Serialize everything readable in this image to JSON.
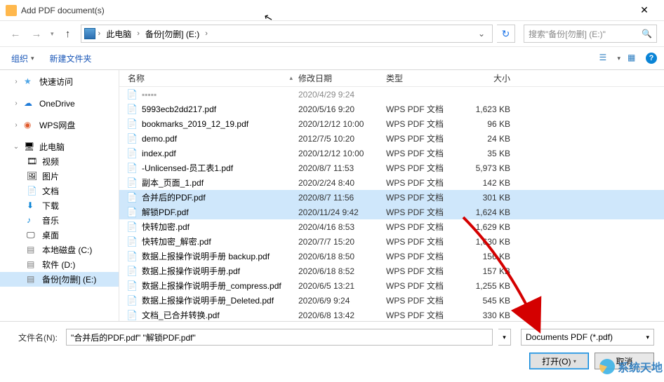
{
  "title": "Add PDF document(s)",
  "breadcrumb": {
    "root": "此电脑",
    "folder": "备份[勿删] (E:)"
  },
  "search": {
    "placeholder": "搜索\"备份[勿删] (E:)\""
  },
  "toolbar": {
    "organize": "组织",
    "newfolder": "新建文件夹"
  },
  "columns": {
    "name": "名称",
    "date": "修改日期",
    "type": "类型",
    "size": "大小"
  },
  "sidebar": {
    "quick": "快速访问",
    "onedrive": "OneDrive",
    "wps": "WPS网盘",
    "thispc": "此电脑",
    "video": "视频",
    "pic": "图片",
    "doc": "文档",
    "down": "下载",
    "music": "音乐",
    "desk": "桌面",
    "diskc": "本地磁盘 (C:)",
    "diskd": "软件 (D:)",
    "diske": "备份[勿删] (E:)"
  },
  "files": [
    {
      "name": "5993ecb2dd217.pdf",
      "date": "2020/5/16 9:20",
      "type": "WPS PDF 文档",
      "size": "1,623 KB",
      "sel": false
    },
    {
      "name": "bookmarks_2019_12_19.pdf",
      "date": "2020/12/12 10:00",
      "type": "WPS PDF 文档",
      "size": "96 KB",
      "sel": false
    },
    {
      "name": "demo.pdf",
      "date": "2012/7/5 10:20",
      "type": "WPS PDF 文档",
      "size": "24 KB",
      "sel": false
    },
    {
      "name": "index.pdf",
      "date": "2020/12/12 10:00",
      "type": "WPS PDF 文档",
      "size": "35 KB",
      "sel": false
    },
    {
      "name": "-Unlicensed-员工表1.pdf",
      "date": "2020/8/7 11:53",
      "type": "WPS PDF 文档",
      "size": "5,973 KB",
      "sel": false
    },
    {
      "name": "副本_页面_1.pdf",
      "date": "2020/2/24 8:40",
      "type": "WPS PDF 文档",
      "size": "142 KB",
      "sel": false
    },
    {
      "name": "合并后的PDF.pdf",
      "date": "2020/8/7 11:56",
      "type": "WPS PDF 文档",
      "size": "301 KB",
      "sel": true
    },
    {
      "name": "解锁PDF.pdf",
      "date": "2020/11/24 9:42",
      "type": "WPS PDF 文档",
      "size": "1,624 KB",
      "sel": true
    },
    {
      "name": "快转加密.pdf",
      "date": "2020/4/16 8:53",
      "type": "WPS PDF 文档",
      "size": "1,629 KB",
      "sel": false
    },
    {
      "name": "快转加密_解密.pdf",
      "date": "2020/7/7 15:20",
      "type": "WPS PDF 文档",
      "size": "1,630 KB",
      "sel": false
    },
    {
      "name": "数据上报操作说明手册 backup.pdf",
      "date": "2020/6/18 8:50",
      "type": "WPS PDF 文档",
      "size": "156 KB",
      "sel": false
    },
    {
      "name": "数据上报操作说明手册.pdf",
      "date": "2020/6/18 8:52",
      "type": "WPS PDF 文档",
      "size": "157 KB",
      "sel": false
    },
    {
      "name": "数据上报操作说明手册_compress.pdf",
      "date": "2020/6/5 13:21",
      "type": "WPS PDF 文档",
      "size": "1,255 KB",
      "sel": false
    },
    {
      "name": "数据上报操作说明手册_Deleted.pdf",
      "date": "2020/6/9 9:24",
      "type": "WPS PDF 文档",
      "size": "545 KB",
      "sel": false
    },
    {
      "name": "文档_已合并转换.pdf",
      "date": "2020/6/8 13:42",
      "type": "WPS PDF 文档",
      "size": "330 KB",
      "sel": false
    }
  ],
  "truncated_row": {
    "date": "2020/4/29 9:24"
  },
  "bottom": {
    "label": "文件名(N):",
    "value": "\"合并后的PDF.pdf\" \"解锁PDF.pdf\"",
    "filter": "Documents PDF (*.pdf)",
    "open": "打开(O)",
    "cancel": "取消"
  },
  "watermark": "系统天地"
}
